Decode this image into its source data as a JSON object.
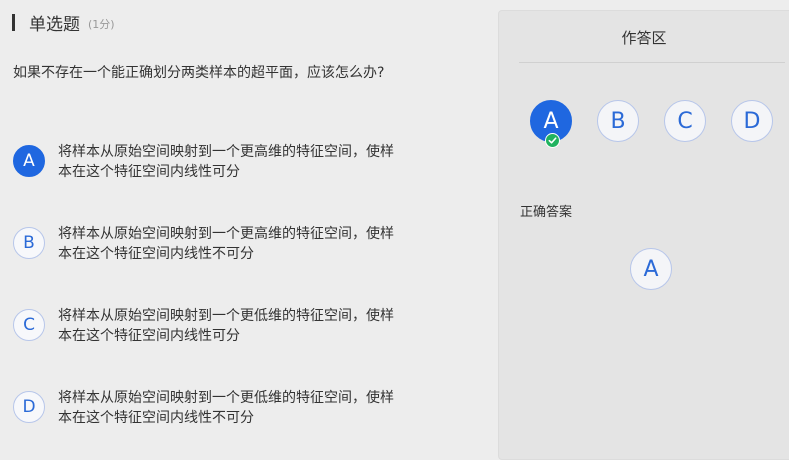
{
  "section": {
    "title": "单选题",
    "score": "(1分)"
  },
  "question": {
    "text": "如果不存在一个能正确划分两类样本的超平面，应该怎么办?"
  },
  "options": [
    {
      "letter": "A",
      "line1": "将样本从原始空间映射到一个更高维的特征空间，使样",
      "line2": "本在这个特征空间内线性可分",
      "selected": true
    },
    {
      "letter": "B",
      "line1": "将样本从原始空间映射到一个更高维的特征空间，使样",
      "line2": "本在这个特征空间内线性不可分",
      "selected": false
    },
    {
      "letter": "C",
      "line1": "将样本从原始空间映射到一个更低维的特征空间，使样",
      "line2": "本在这个特征空间内线性可分",
      "selected": false
    },
    {
      "letter": "D",
      "line1": "将样本从原始空间映射到一个更低维的特征空间，使样",
      "line2": "本在这个特征空间内线性不可分",
      "selected": false
    }
  ],
  "answer_panel": {
    "title": "作答区",
    "choices": [
      "A",
      "B",
      "C",
      "D"
    ],
    "selected": "A",
    "correct_label": "正确答案",
    "correct_answer": "A"
  },
  "colors": {
    "accent": "#1f67e0",
    "success": "#21b35f",
    "background": "#ededed"
  }
}
